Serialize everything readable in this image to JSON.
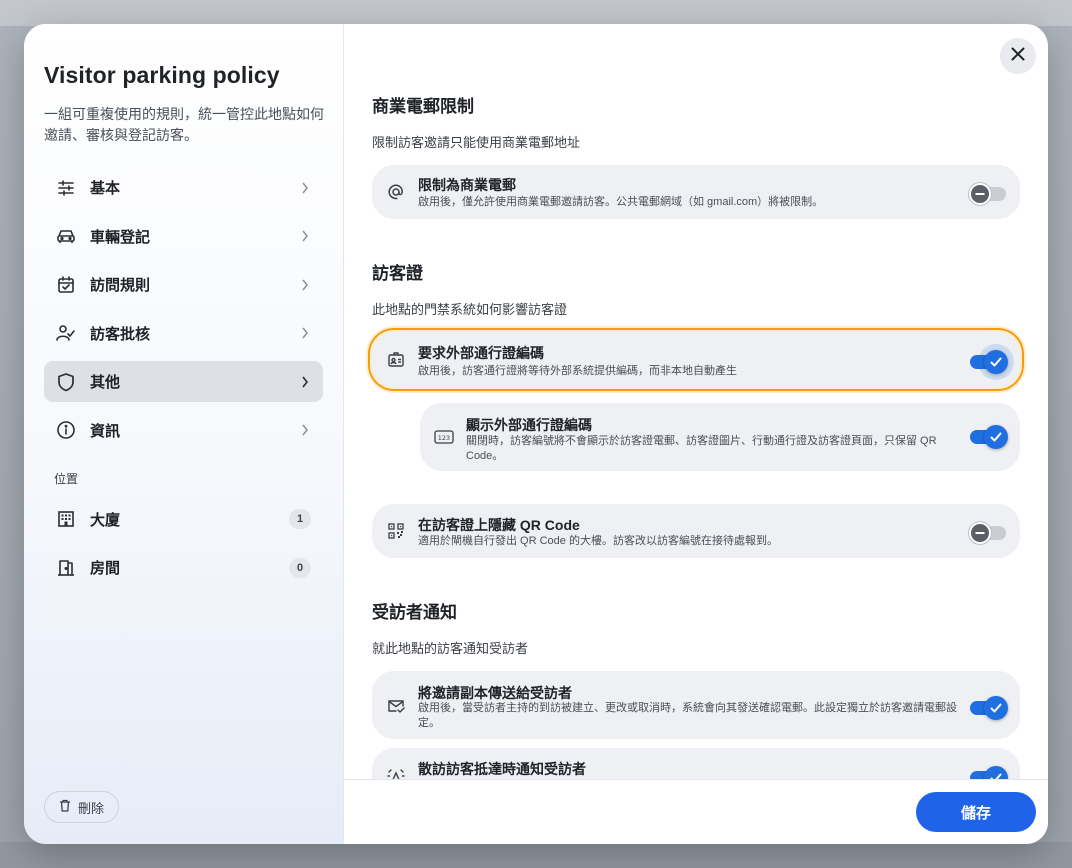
{
  "modal": {
    "title": "Visitor parking policy",
    "description": "一組可重複使用的規則，統一管控此地點如何邀請、審核與登記訪客。",
    "close_icon": "close-icon"
  },
  "sidebar": {
    "items": [
      {
        "label": "基本",
        "icon": "sliders-icon"
      },
      {
        "label": "車輛登記",
        "icon": "car-icon"
      },
      {
        "label": "訪問規則",
        "icon": "calendar-check-icon"
      },
      {
        "label": "訪客批核",
        "icon": "user-check-icon"
      },
      {
        "label": "其他",
        "icon": "shield-icon",
        "active": true
      },
      {
        "label": "資訊",
        "icon": "info-icon"
      }
    ],
    "location_label": "位置",
    "locations": [
      {
        "label": "大廈",
        "count": "1",
        "icon": "building-icon"
      },
      {
        "label": "房間",
        "count": "0",
        "icon": "door-icon"
      }
    ],
    "delete_label": "刪除"
  },
  "sections": {
    "business_email": {
      "title": "商業電郵限制",
      "description": "限制訪客邀請只能使用商業電郵地址",
      "card": {
        "title": "限制為商業電郵",
        "subtitle": "啟用後，僅允許使用商業電郵邀請訪客。公共電郵網域（如 gmail.com）將被限制。",
        "enabled": false
      }
    },
    "visitor_pass": {
      "title": "訪客證",
      "description": "此地點的門禁系統如何影響訪客證",
      "require_external": {
        "title": "要求外部通行證編碼",
        "subtitle": "啟用後，訪客通行證將等待外部系統提供編碼，而非本地自動產生",
        "enabled": true
      },
      "show_external": {
        "title": "顯示外部通行證編碼",
        "subtitle": "關閉時，訪客編號將不會顯示於訪客證電郵、訪客證圖片、行動通行證及訪客證頁面，只保留 QR Code。",
        "enabled": true
      },
      "hide_qr": {
        "title": "在訪客證上隱藏 QR Code",
        "subtitle": "適用於閘機自行發出 QR Code 的大樓。訪客改以訪客編號在接待處報到。",
        "enabled": false
      }
    },
    "host_notify": {
      "title": "受訪者通知",
      "description": "就此地點的訪客通知受訪者",
      "send_copy": {
        "title": "將邀請副本傳送給受訪者",
        "subtitle": "啟用後，當受訪者主持的到訪被建立、更改或取消時，系統會向其發送確認電郵。此設定獨立於訪客邀請電郵設定。",
        "enabled": true
      },
      "walkin_arrival": {
        "title": "散訪訪客抵達時通知受訪者",
        "enabled": true
      }
    }
  },
  "footer": {
    "save_label": "儲存"
  },
  "colors": {
    "accent": "#1f63e8",
    "highlight": "#f59e0b"
  }
}
